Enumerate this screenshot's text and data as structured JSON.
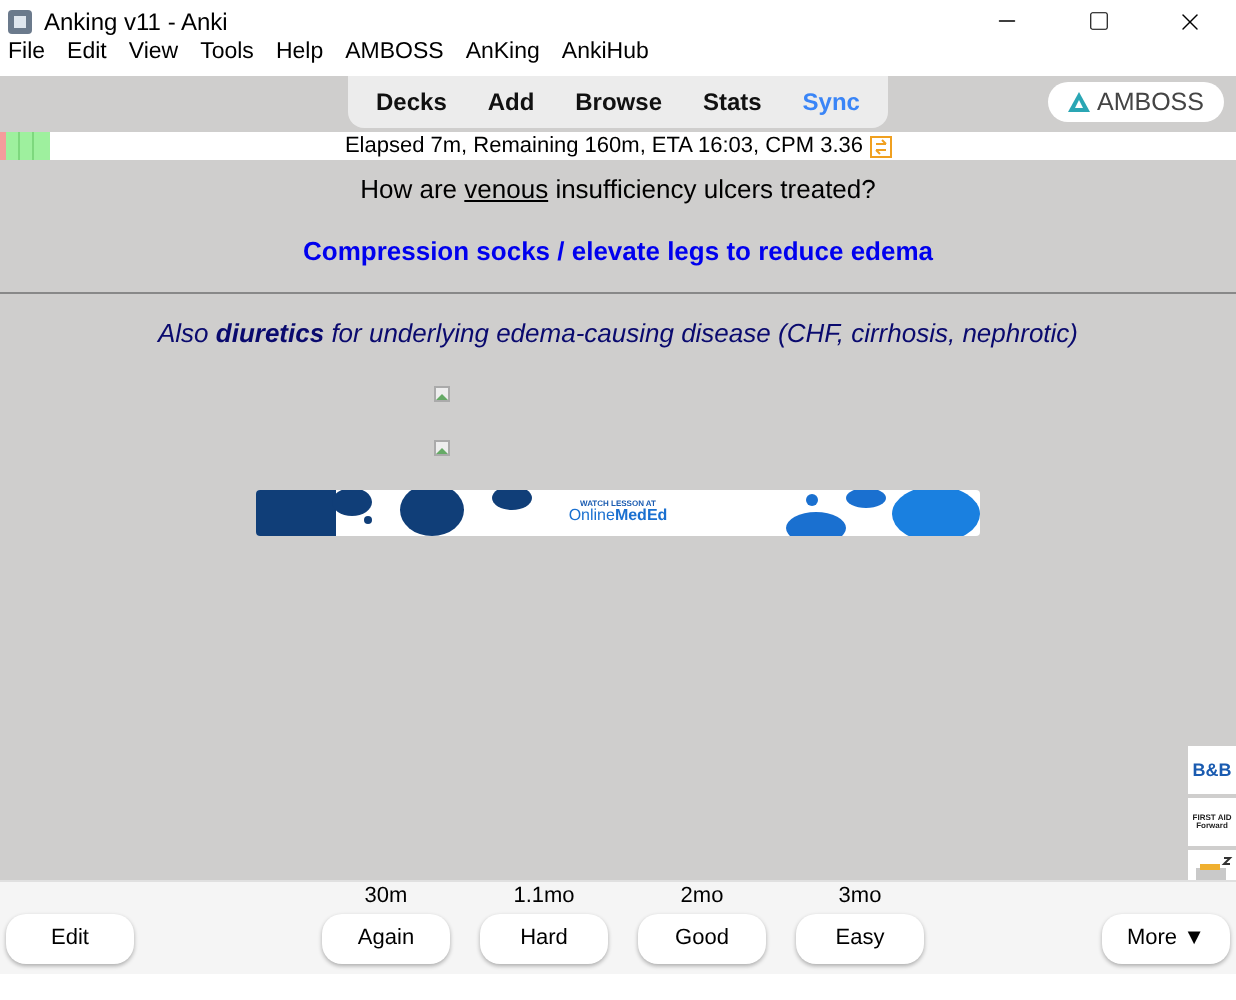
{
  "window": {
    "title": "Anking v11 - Anki"
  },
  "menu": [
    "File",
    "Edit",
    "View",
    "Tools",
    "Help",
    "AMBOSS",
    "AnKing",
    "AnkiHub"
  ],
  "nav": [
    {
      "label": "Decks",
      "selected": false
    },
    {
      "label": "Add",
      "selected": false
    },
    {
      "label": "Browse",
      "selected": false
    },
    {
      "label": "Stats",
      "selected": false
    },
    {
      "label": "Sync",
      "selected": true
    }
  ],
  "amboss_button": "AMBOSS",
  "progress": {
    "status": "Elapsed 7m, Remaining 160m, ETA 16:03, CPM 3.36"
  },
  "card": {
    "question": [
      {
        "text": "How are ",
        "underline": false
      },
      {
        "text": "venous",
        "underline": true
      },
      {
        "text": " insufficiency ulcers treated?",
        "underline": false
      }
    ],
    "answer": "Compression socks / elevate legs to reduce edema",
    "extra": "Also **diuretics** for underlying edema-causing disease (CHF, cirrhosis, nephrotic)",
    "banner": {
      "caption": "WATCH LESSON AT",
      "brand_light": "Online",
      "brand_bold": "MedEd"
    }
  },
  "side_icons": [
    {
      "kind": "text",
      "label": "B&B"
    },
    {
      "kind": "text",
      "label": "FIRST AID Forward"
    },
    {
      "kind": "drawing"
    }
  ],
  "answer_buttons": [
    {
      "interval": "30m",
      "label": "Again"
    },
    {
      "interval": "1.1mo",
      "label": "Hard"
    },
    {
      "interval": "2mo",
      "label": "Good"
    },
    {
      "interval": "3mo",
      "label": "Easy"
    }
  ],
  "edit_button": "Edit",
  "more_button": "More ▼"
}
